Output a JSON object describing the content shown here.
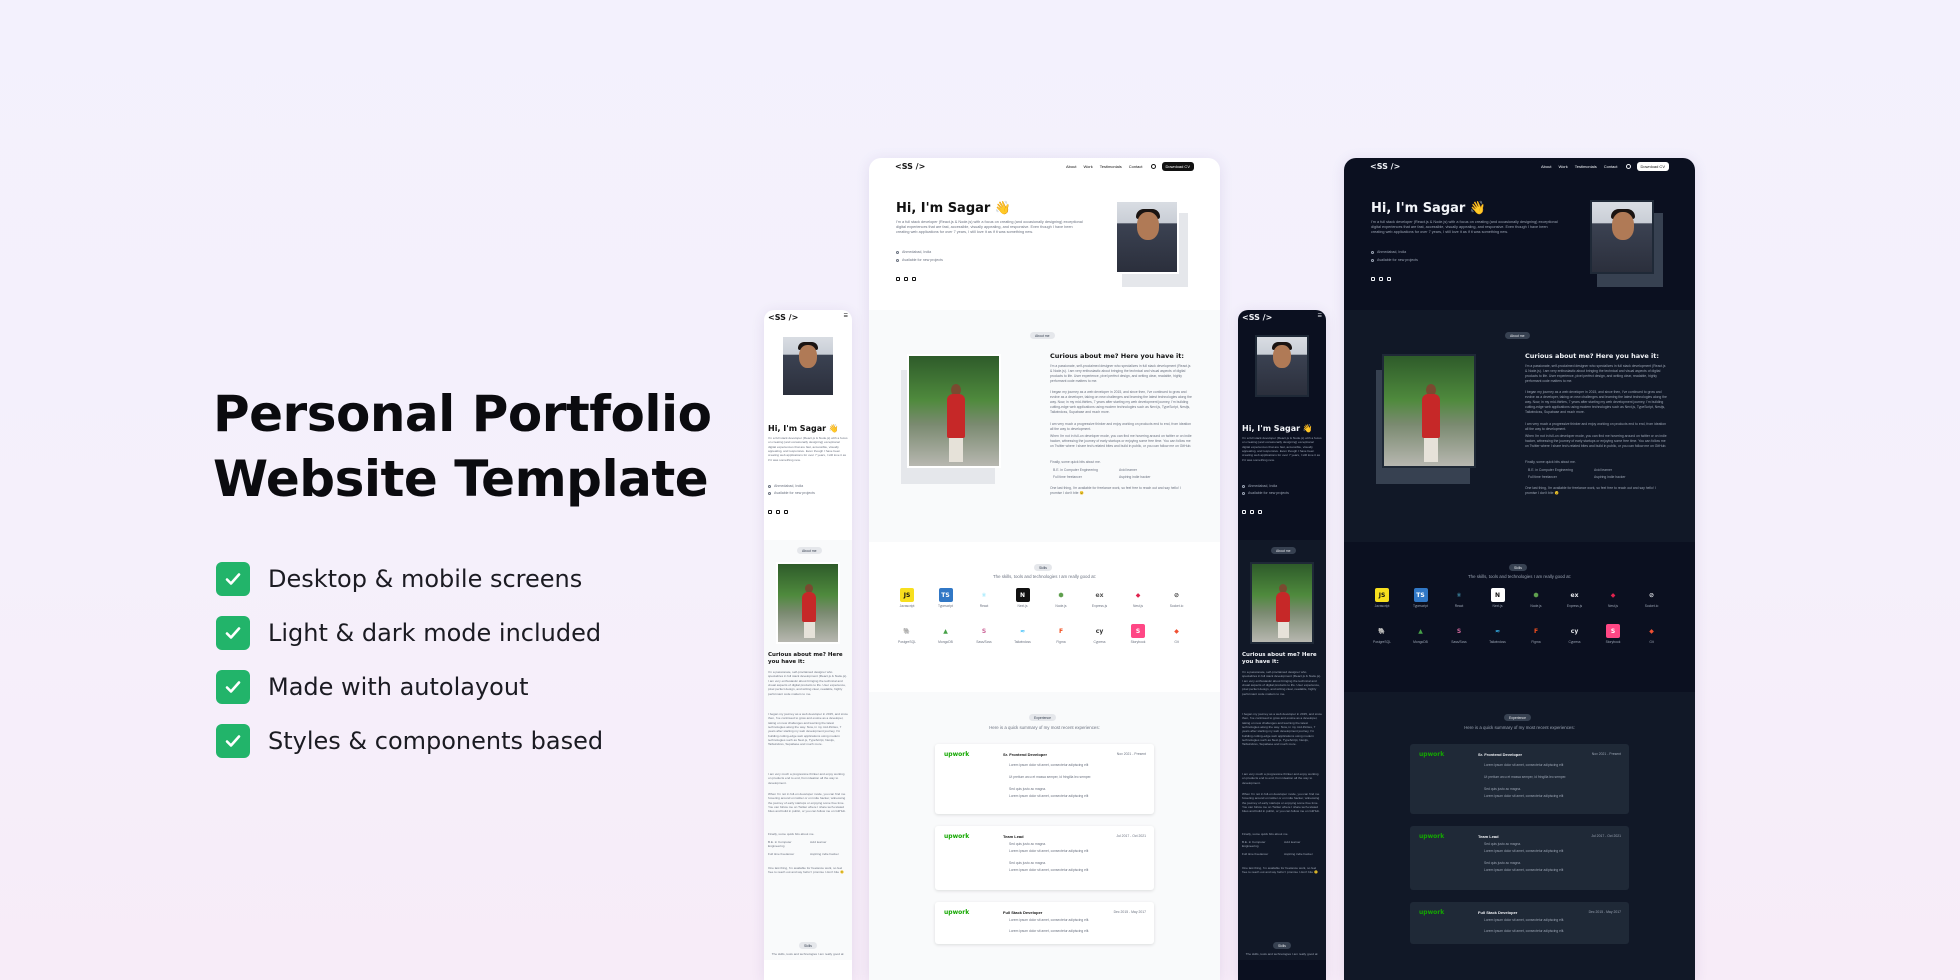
{
  "hero": {
    "title_line1": "Personal Portfolio",
    "title_line2": "Website Template"
  },
  "features": [
    {
      "label": "Desktop & mobile screens"
    },
    {
      "label": "Light & dark mode included"
    },
    {
      "label": "Made with autolayout"
    },
    {
      "label": "Styles & components based"
    }
  ],
  "colors": {
    "check": "#22b46a",
    "dark_bg": "#0b1020",
    "upwork": "#14a800"
  },
  "site": {
    "logo": "<SS />",
    "nav": [
      "About",
      "Work",
      "Testimonials",
      "Contact"
    ],
    "download": "Download CV",
    "greeting": "Hi, I'm Sagar 👋",
    "intro": "I'm a full stack developer (React.js & Node.js) with a focus on creating (and occasionally designing) exceptional digital experiences that are fast, accessible, visually appealing, and responsive. Even though I have been creating web applications for over 7 years, I still love it as if it was something new.",
    "location": "Ahmedabad, India",
    "availability": "Available for new projects",
    "about_pill": "About me",
    "about_heading": "Curious about me? Here you have it:",
    "about_p1": "I'm a passionate, self-proclaimed designer who specializes in full stack development (React.js & Node.js). I am very enthusiastic about bringing the technical and visual aspects of digital products to life. User experience, pixel perfect design, and writing clear, readable, highly performant code matters to me.",
    "about_p2": "I began my journey as a web developer in 2015, and since then, I've continued to grow and evolve as a developer, taking on new challenges and learning the latest technologies along the way. Now, in my mid-thirties, 7 years after starting my web development journey, I'm building cutting-edge web applications using modern technologies such as Next.js, TypeScript, Nestjs, Tailwindcss, Supabase and much more.",
    "about_p3": "I am very much a progressive thinker and enjoy working on products end to end, from ideation all the way to development.",
    "about_p4": "When I'm not in full-on developer mode, you can find me hovering around on twitter or on indie hacker, witnessing the journey of early startups or enjoying some free time. You can follow me on Twitter where I share tech-related bites and build in public, or you can follow me on GitHub.",
    "about_p5": "Finally, some quick bits about me.",
    "bullets": [
      "B.E. in Computer Engineering",
      "Full time freelancer",
      "Avid learner",
      "Aspiring indie hacker"
    ],
    "about_p6": "One last thing, I'm available for freelance work, so feel free to reach out and say hello! I promise I don't bite 😉",
    "skills_pill": "Skills",
    "skills_sub": "The skills, tools and technologies I am really good at:",
    "skills": [
      {
        "name": "Javascript",
        "glyph": "JS",
        "color": "#f7df1e",
        "fg": "#111"
      },
      {
        "name": "Typescript",
        "glyph": "TS",
        "color": "#3178c6",
        "fg": "#fff"
      },
      {
        "name": "React",
        "glyph": "⚛",
        "color": "transparent",
        "fg": "#61dafb"
      },
      {
        "name": "Next.js",
        "glyph": "N",
        "color": "#111",
        "fg": "#fff"
      },
      {
        "name": "Node.js",
        "glyph": "⬢",
        "color": "transparent",
        "fg": "#5fa04e"
      },
      {
        "name": "Express.js",
        "glyph": "ex",
        "color": "transparent",
        "fg": "#555"
      },
      {
        "name": "Nest.js",
        "glyph": "◆",
        "color": "transparent",
        "fg": "#e0234e"
      },
      {
        "name": "Socket.io",
        "glyph": "⊘",
        "color": "transparent",
        "fg": "#333"
      },
      {
        "name": "PostgreSQL",
        "glyph": "🐘",
        "color": "transparent",
        "fg": "#336791"
      },
      {
        "name": "MongoDB",
        "glyph": "▲",
        "color": "transparent",
        "fg": "#47a248"
      },
      {
        "name": "Sass/Scss",
        "glyph": "S",
        "color": "transparent",
        "fg": "#cc6699"
      },
      {
        "name": "Tailwindcss",
        "glyph": "≈",
        "color": "transparent",
        "fg": "#38bdf8"
      },
      {
        "name": "Figma",
        "glyph": "F",
        "color": "transparent",
        "fg": "#f24e1e"
      },
      {
        "name": "Cypress",
        "glyph": "cy",
        "color": "transparent",
        "fg": "#333"
      },
      {
        "name": "Storybook",
        "glyph": "S",
        "color": "#ff4785",
        "fg": "#fff"
      },
      {
        "name": "Git",
        "glyph": "◆",
        "color": "transparent",
        "fg": "#f05032"
      }
    ],
    "exp_pill": "Experience",
    "exp_sub": "Here is a quick summary of my most recent experiences:",
    "experience": [
      {
        "company": "upwork",
        "role": "Sr. Frontend Developer",
        "dates": "Nov 2021 - Present",
        "lines": [
          "Lorem ipsum dolor sit amet, consectetur adipiscing elit",
          "Ut pretium arcu et massa semper, id fringilla leo semper.",
          "Sed quis justo ac magna.",
          "Lorem ipsum dolor sit amet, consectetur adipiscing elit"
        ]
      },
      {
        "company": "upwork",
        "role": "Team Lead",
        "dates": "Jul 2017 - Oct 2021",
        "lines": [
          "Sed quis justo ac magna.",
          "Lorem ipsum dolor sit amet, consectetur adipiscing elit",
          "Sed quis justo ac magna.",
          "Lorem ipsum dolor sit amet, consectetur adipiscing elit"
        ]
      },
      {
        "company": "upwork",
        "role": "Full Stack Developer",
        "dates": "Dec 2015 - May 2017",
        "lines": [
          "Lorem ipsum dolor sit amet, consectetur adipiscing elit.",
          "Lorem ipsum dolor sit amet, consectetur adipiscing elit."
        ]
      }
    ]
  },
  "mobile": {
    "skills_sub": "The skills, tools and technologies I am really good at:"
  }
}
